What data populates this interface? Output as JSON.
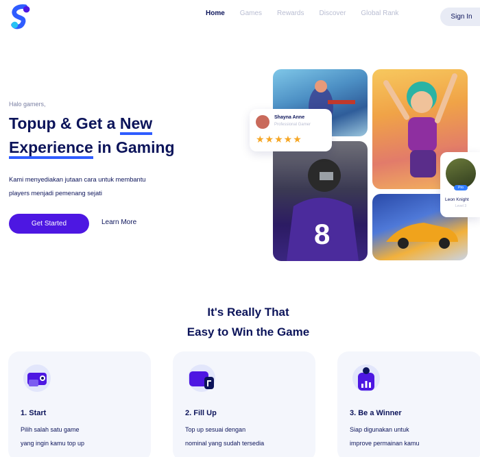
{
  "brand": {
    "logo_icon": "brand-logo-icon",
    "accent": "#4d17e2",
    "highlight": "#2f5cff",
    "text_dark": "#0c145a"
  },
  "nav": {
    "items": [
      {
        "label": "Home"
      },
      {
        "label": "Games"
      },
      {
        "label": "Rewards"
      },
      {
        "label": "Discover"
      },
      {
        "label": "Global Rank"
      }
    ],
    "signin_label": "Sign In"
  },
  "hero": {
    "greeting": "Halo gamers,",
    "title_part1": "Topup & Get a ",
    "title_highlight1": "New",
    "title_highlight2": "Experience",
    "title_part2": " in Gaming",
    "subtitle_line1": "Kami menyediakan jutaan cara untuk membantu",
    "subtitle_line2": "players menjadi pemenang sejati",
    "cta_primary": "Get Started",
    "cta_secondary": "Learn More"
  },
  "rating_card": {
    "name": "Shayna Anne",
    "role": "Professional Gamer",
    "stars": "★★★★★"
  },
  "player_card": {
    "name": "Leon Knight",
    "level": "Level 3",
    "badge": "Pro"
  },
  "steps_section": {
    "title_line1": "It's Really That",
    "title_line2": "Easy to Win the Game",
    "steps": [
      {
        "title": "1. Start",
        "desc_line1": "Pilih salah satu game",
        "desc_line2": "yang ingin kamu top up",
        "icon": "game-controller-icon"
      },
      {
        "title": "2. Fill Up",
        "desc_line1": "Top up sesuai dengan",
        "desc_line2": "nominal yang sudah tersedia",
        "icon": "wallet-card-icon"
      },
      {
        "title": "3. Be a Winner",
        "desc_line1": "Siap digunakan untuk",
        "desc_line2": "improve permainan kamu",
        "icon": "trophy-chart-icon"
      }
    ]
  }
}
